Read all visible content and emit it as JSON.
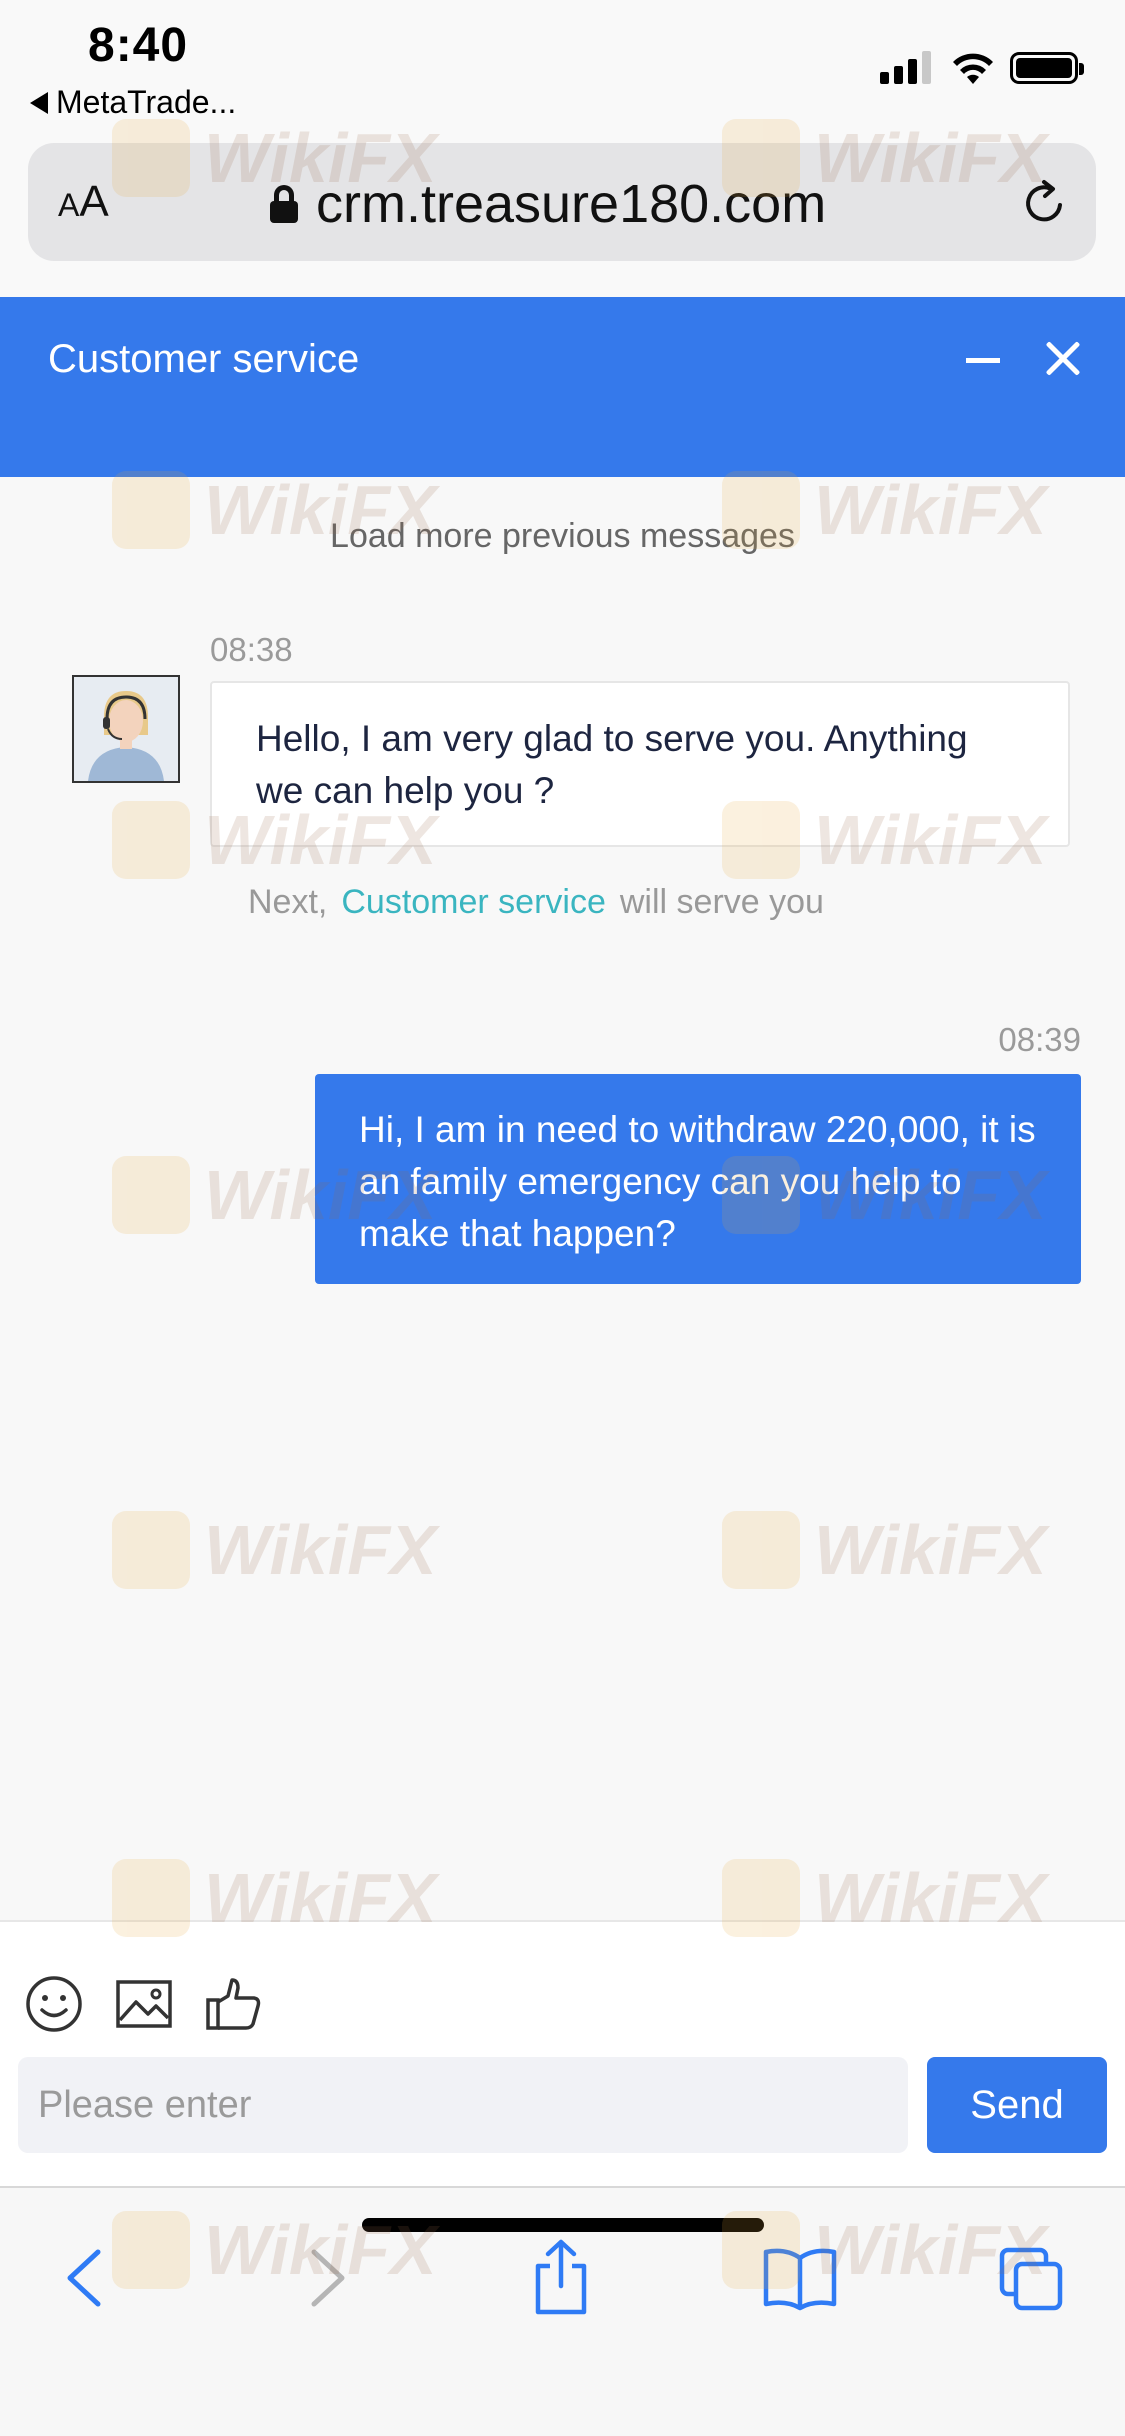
{
  "status_bar": {
    "time": "8:40",
    "back_app": "MetaTrade..."
  },
  "address_bar": {
    "text_size_small": "A",
    "text_size_large": "A",
    "url": "crm.treasure180.com"
  },
  "chat": {
    "title": "Customer service",
    "load_more": "Load more previous messages",
    "messages": [
      {
        "sender": "agent",
        "time": "08:38",
        "text": "Hello, I am very glad to serve you. Anything we can help you ?"
      },
      {
        "sender": "user",
        "time": "08:39",
        "text": "Hi, I am in need to withdraw 220,000, it is an family emergency can you help to make that happen?"
      }
    ],
    "next_line": {
      "prefix": "Next,",
      "link": "Customer service",
      "suffix": "will serve you"
    }
  },
  "input": {
    "placeholder": "Please enter",
    "value": "",
    "send_label": "Send"
  },
  "watermark": {
    "text": "WikiFX"
  },
  "colors": {
    "accent": "#3579eb",
    "link": "#3ab5c0",
    "safari_blue": "#2f7bf5"
  },
  "icons": {
    "toolbar": [
      "emoji-icon",
      "image-icon",
      "thumbs-up-icon"
    ],
    "safari": [
      "back-arrow-icon",
      "forward-arrow-icon",
      "share-icon",
      "bookmarks-icon",
      "tabs-icon"
    ]
  }
}
